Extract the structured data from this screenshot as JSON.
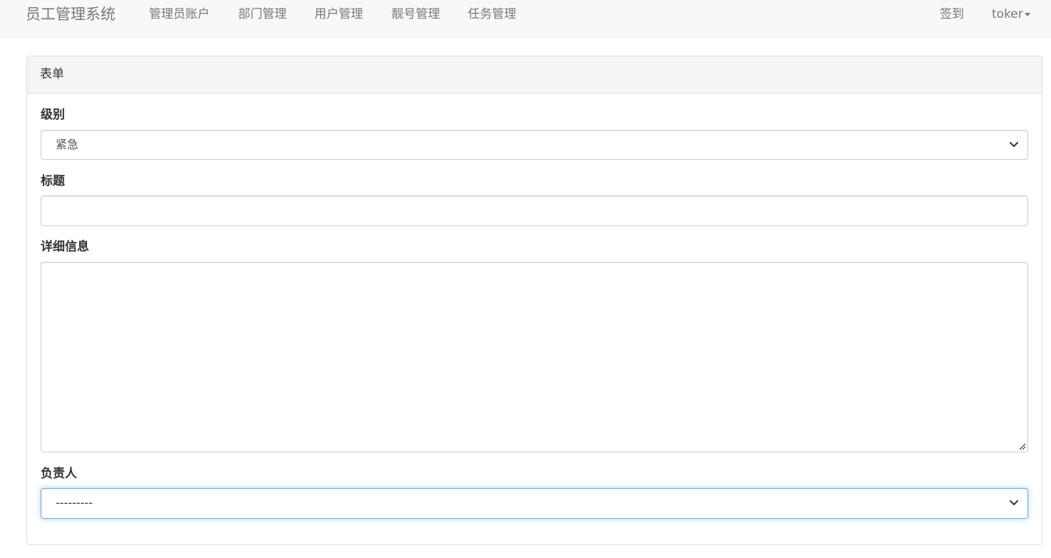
{
  "navbar": {
    "brand": "员工管理系统",
    "items": [
      {
        "label": "管理员账户"
      },
      {
        "label": "部门管理"
      },
      {
        "label": "用户管理"
      },
      {
        "label": "靓号管理"
      },
      {
        "label": "任务管理"
      }
    ],
    "right": {
      "checkin": "签到",
      "user": "toker",
      "user_icon": "caret-down-icon"
    }
  },
  "panel": {
    "title": "表单"
  },
  "form": {
    "level": {
      "label": "级别",
      "value": "紧急"
    },
    "title": {
      "label": "标题",
      "value": ""
    },
    "detail": {
      "label": "详细信息",
      "value": ""
    },
    "owner": {
      "label": "负责人",
      "value": "---------"
    }
  },
  "colors": {
    "navbar_bg": "#f8f8f8",
    "nav_text": "#777777",
    "panel_heading_bg": "#f5f5f5",
    "focus_border": "#66afe9"
  }
}
